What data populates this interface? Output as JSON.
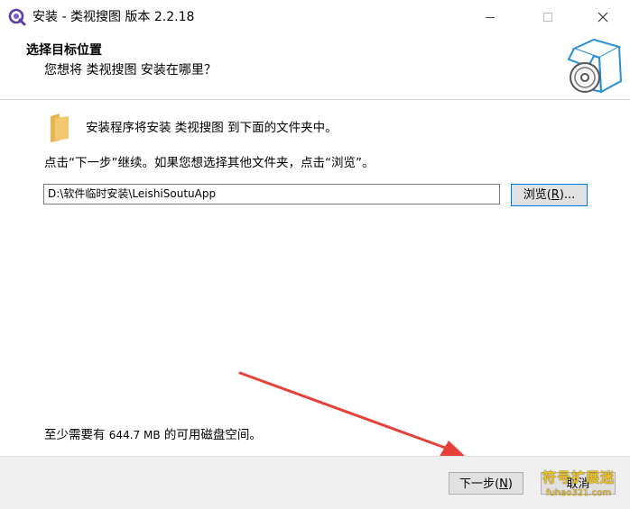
{
  "window": {
    "title": "安装 - 类视搜图 版本 2.2.18",
    "app_icon": "q-search-logo-icon",
    "controls": [
      "minimize-icon",
      "maximize-icon",
      "close-icon"
    ]
  },
  "header": {
    "title": "选择目标位置",
    "subtitle": "您想将 类视搜图 安装在哪里？",
    "image": "installer-box-disc-icon"
  },
  "main": {
    "folder_icon": "folder-icon",
    "install_desc": "安装程序将安装 类视搜图 到下面的文件夹中。",
    "continue_text": "点击“下一步”继续。如果您想选择其他文件夹，点击“浏览”。",
    "path_value": "D:\\软件临时安装\\LeishiSoutuApp",
    "browse_label": "浏览",
    "browse_key": "R",
    "browse_suffix": "...",
    "space_prefix": "至少需要有",
    "space_amount": "644.7 MB",
    "space_suffix": "的可用磁盘空间。"
  },
  "footer": {
    "next_label": "下一步",
    "next_key": "N",
    "cancel_label": "取消",
    "watermark_top": "符号扩展迷",
    "watermark_bottom": "fuhao321.com"
  },
  "colors": {
    "accent": "#0078d7",
    "arrow": "#e8403a",
    "folder": "#f3c76e",
    "watermark": "#f2c61a"
  }
}
